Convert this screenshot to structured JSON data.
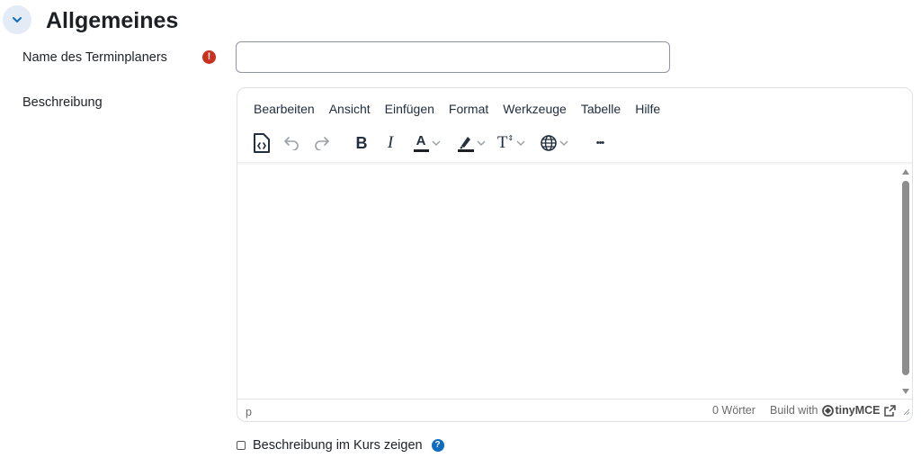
{
  "section": {
    "title": "Allgemeines"
  },
  "name_field": {
    "label": "Name des Terminplaners",
    "value": "",
    "required_icon": "!"
  },
  "description_field": {
    "label": "Beschreibung"
  },
  "editor": {
    "menu": [
      "Bearbeiten",
      "Ansicht",
      "Einfügen",
      "Format",
      "Werkzeuge",
      "Tabelle",
      "Hilfe"
    ],
    "toolbar_icons": [
      "source-code-icon",
      "undo-icon",
      "redo-icon",
      "bold-icon",
      "italic-icon",
      "text-color-icon",
      "highlight-color-icon",
      "font-size-icon",
      "language-icon",
      "more-icon"
    ],
    "toolbar_glyphs": {
      "bold": "B",
      "italic": "I",
      "text_color": "A",
      "font_size": "T",
      "more": "•••"
    },
    "status_path": "p",
    "word_count": "0 Wörter",
    "branding": {
      "prefix": "Build with",
      "brand": "tinyMCE"
    }
  },
  "show_description": {
    "label": "Beschreibung im Kurs zeigen",
    "checked": false,
    "help_icon": "?"
  },
  "colors": {
    "accent_blue": "#0f6cbf",
    "required_red": "#ca3120",
    "collapse_bg": "#e2ebf6"
  }
}
